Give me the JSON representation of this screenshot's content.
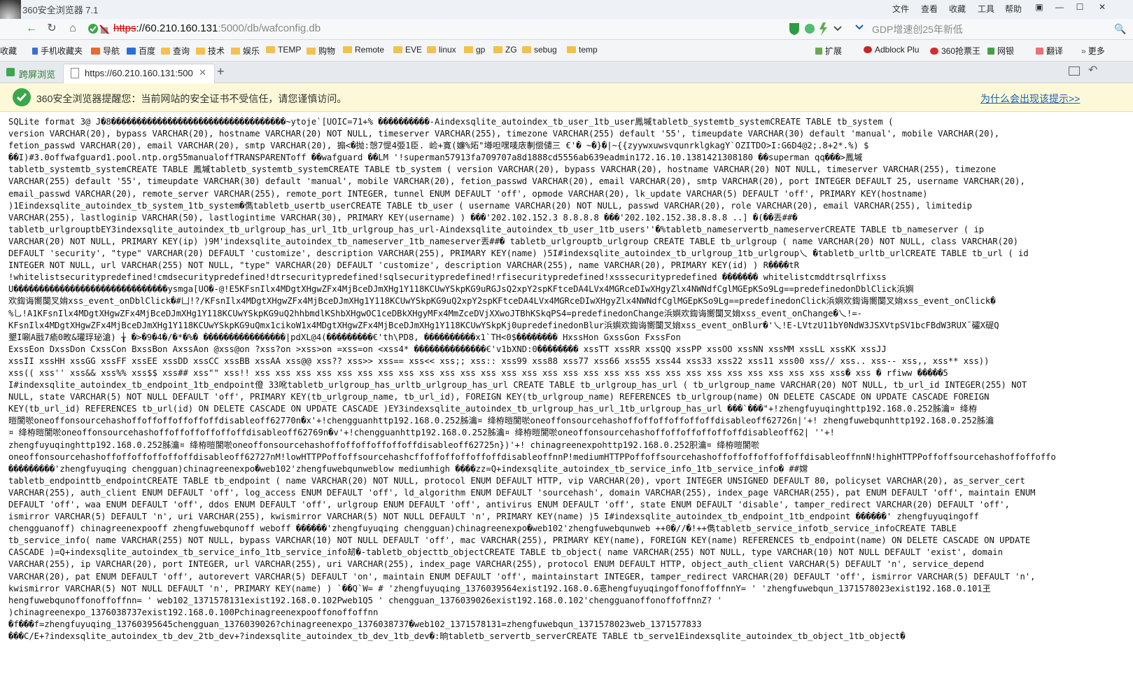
{
  "titlebar": {
    "app_title": "360安全浏览器 7.1",
    "menu": [
      "文件",
      "查看",
      "收藏",
      "工具",
      "帮助"
    ],
    "controls": [
      "▣",
      "—",
      "☐",
      "✕"
    ]
  },
  "navbar": {
    "url_scheme": "https",
    "url_host": "://60.210.160.131",
    "url_rest": ":5000/db/wafconfig.db",
    "search_placeholder": "GDP增速创25年新低"
  },
  "bookmarks": {
    "items": [
      "收藏",
      "手机收藏夹",
      "导航",
      "百度",
      "查询",
      "技术",
      "娱乐",
      "TEMP",
      "购物",
      "Remote",
      "EVE",
      "linux",
      "gp",
      "ZG",
      "sebug",
      "temp"
    ],
    "right_items": [
      "扩展",
      "Adblock Plu",
      "360抢票王",
      "网银",
      "翻译",
      "更多"
    ]
  },
  "tabs": [
    {
      "label": "跨屏浏览"
    },
    {
      "label": "https://60.210.160.131:5000/"
    }
  ],
  "notice": {
    "text": "360安全浏览器提醒您：当前网站的安全证书不受信任，请您谨慎访问。",
    "link": "为什么会出现该提示>>"
  },
  "content": {
    "lines": [
      "SQLite format 3@ J�8����������������������������������~ytoje`[UOIC=71+% ����������-Aindexsqlite_autoindex_tb_user_1tb_user鳳墄tabletb_systemtb_systemCREATE TABLE tb_system (",
      "version VARCHAR(20), bypass VARCHAR(20), hostname VARCHAR(20) NOT NULL, timeserver VARCHAR(255), timezone VARCHAR(255) default '55', timeupdate VARCHAR(30) default 'manual', mobile VARCHAR(20),",
      "fetion_passwd VARCHAR(20), email VARCHAR(20), smtp VARCHAR(20), 搧<�抛:愨7惿4弫1臣. 崄+寛(嬚%炻\"墫呾嘿唛庡剸偿儙三  €'� ~�}�|~{{zyywxuwsvqunrklgkagY`OZITDO>I:G6D4@2;.8+2*.%) $",
      "��I)#3.0offwafguard1.pool.ntp.org55manualoffTRANSPARENToff ��wafguard ��LM '!superman57913fa709707a8d1888cd5556ab639eadmin172.16.10.1381421308180 ��superman qq���>鳳墄",
      "tabletb_systemtb_systemCREATE TABLE 鳳墄tabletb_systemtb_systemCREATE TABLE tb_system ( version VARCHAR(20), bypass VARCHAR(20), hostname VARCHAR(20) NOT NULL, timeserver VARCHAR(255), timezone",
      "VARCHAR(255) default '55', timeupdate VARCHAR(30) default 'manual', mobile VARCHAR(20), fetion_passwd VARCHAR(20), email VARCHAR(20), smtp VARCHAR(20), port INTEGER DEFAULT 25, username VARCHAR(20),",
      "email_passwd VARCHAR(20), remote_server VARCHAR(255), remote_port INTEGER, tunnel ENUM DEFAULT 'off', opmode VARCHAR(20), lk_update VARCHAR(5) DEFAULT 'off', PRIMARY KEY(hostname)",
      ")1Eindexsqlite_autoindex_tb_system_1tb_system�儁tabletb_usertb_userCREATE TABLE tb_user ( username VARCHAR(20) NOT NULL, passwd VARCHAR(20), role VARCHAR(20), email VARCHAR(255), limitedip",
      "VARCHAR(255), lastloginip VARCHAR(50), lastlogintime VARCHAR(30), PRIMARY KEY(username) ) ���'202.102.152.3 8.8.8.8 ���'202.102.152.38.8.8.8 ..] �(��丟##�",
      "tabletb_urlgrouptbEY3indexsqlite_autoindex_tb_urlgroup_has_url_1tb_urlgroup_has_url-Aindexsqlite_autoindex_tb_user_1tb_users''�%tabletb_nameservertb_nameserverCREATE TABLE tb_nameserver ( ip",
      "VARCHAR(20) NOT NULL, PRIMARY KEY(ip) )9M'indexsqlite_autoindex_tb_nameserver_1tb_nameserver丟##� tabletb_urlgrouptb_urlgroup CREATE TABLE tb_urlgroup ( name VARCHAR(20) NOT NULL, class VARCHAR(20)",
      "DEFAULT 'security', \"type\" VARCHAR(20) DEFAULT 'customize', description VARCHAR(255), PRIMARY KEY(name) )5I#indexsqlite_autoindex_tb_urlgroup_1tb_urlgroup乀 �tabletb_urltb_urlCREATE TABLE tb_url ( id",
      "INTEGER NOT NULL, url VARCHAR(255) NOT NULL, \"type\" VARCHAR(20) DEFAULT 'customize', description VARCHAR(255), name VARCHAR(20), PRIMARY KEY(id) ) R����tR",
      "!whitelistsecuritypredefined!cmdsecuritypredefined!dtrsecuritypredefined!sqlsecuritypredefined!rfisecuritypredefined!xsssecuritypredefined ������� whitelistcmddtrsqlrfixss",
      "U������������������������������ysmga[UO�-@!E5KFsnIlx4MDgtXHgwZFx4MjBceDJmXHg1Y118KCUwYSkpKG9uRGJsQ2xpY2spKFtceDA4LVx4MGRceDIwXHgyZlx4NWNdfCglMGEpKSo9Lg==predefinedonDblClick浜嬩",
      "欢鍧诲嚮闅叉姢xss_event_onDblClick�#凵!?/KFsnIlx4MDgtXHgwZFx4MjBceDJmXHg1Y118KCUwYSkpKG9uQ2xpY2spKFtceDA4LVx4MGRceDIwXHgyZlx4NWNdfCglMGEpKSo9Lg==predefinedonClick浜嬩欢鍧诲嚮闅叉姢xss_event_onClick�",
      "%乚!A1KFsnIlx4MDgtXHgwZFx4MjBceDJmXHg1Y118KCUwYSkpKG9uQ2hhbmdlKShbXHgwOC1ceDBkXHgyMFx4MmZceDVjXXwoJTBhKSkqPS4=predefinedonChange浜嬩欢鍧诲嚮闅叉姢xss_event_onChange�乀!=-",
      "KFsnIlx4MDgtXHgwZFx4MjBceDJmXHg1Y118KCUwYSkpKG9uQmx1cikoW1x4MDgtXHgwZFx4MjBceDJmXHg1Y118KCUwYSkpKj0upredefinedonBlur浜嬩欢鍧诲嚮闅叉姢xss_event_onBlur�'乀!E-LVtzU11bY0NdW3JSXVtpSV1bcFBdW3RUX¯礭X碮Q",
      "墾I唰A戩7瘉0畋&瓘琈珌滄) ╁              �>�9�4�/�*�%�  ����������������|pdXL@4(���������€'th\\PD8, ����������x1`TH<0$�������� HxssHon GxssGon FxssFon",
      "ExssEon DxssDon CxssCon BxssBon AxssAon @xss@on ?xss?on >xss>on =xss=on <xss4* ��������������€'v1bXND:0�������� xssTT xssRR xssQQ xssPP xssOO xssNN xssMM xssLL xssKK xssJJ",
      "xssII xssHH xssGG xssFF xssEE xssDD xssCC xssBB xssAA xss@@ xss?? xss>> xss== xss<< xss;; xss:: xss99 xss88 xss77 xss66 xss55 xss44 xss33 xss22 xss11 xss00 xss// xss.. xss-- xss,, xss** xss))",
      "xss(( xss'' xss&& xss%% xss$$ xss## xss\"\" xss!! xss xss xss xss xss xss xss xss xss xss xss xss xss xss xss xss xss xss xss xss xss xss xss xss xss xss xss xss xss� xss � rfiww �����5",
      "I#indexsqlite_autoindex_tb_endpoint_1tb_endpoint僜 33吪tabletb_urlgroup_has_urltb_urlgroup_has_url CREATE TABLE tb_urlgroup_has_url ( tb_urlgroup_name VARCHAR(20) NOT NULL, tb_url_id INTEGER(255) NOT",
      "NULL, state VARCHAR(5) NOT NULL DEFAULT 'off', PRIMARY KEY(tb_urlgroup_name, tb_url_id), FOREIGN KEY(tb_urlgroup_name) REFERENCES tb_urlgroup(name) ON DELETE CASCADE ON UPDATE CASCADE FOREIGN",
      "KEY(tb_url_id) REFERENCES tb_url(id) ON DELETE CASCADE ON UPDATE CASCADE )EY3indexsqlite_autoindex_tb_urlgroup_has_url_1tb_urlgroup_has_url ���`���\"+!zhengfuyuqinghttp192.168.0.252胏瀹¤  绛栫",
      "暟閬唹oneoffonsourcehashoffoffoffoffoffoffdisableoff62770n�x'+!chengguanhttp192.168.0.252胏瀹¤  绛栫暟閬唹oneoffonsourcehashoffoffoffoffoffoffdisableoff62726n|'+! zhengfuwebqunhttp192.168.0.252胏瀹",
      "¤  绛栫暟閬唹oneoffonsourcehashoffoffoffoffoffoffdisableoff62769n�v'+!chengguanhttp192.168.0.252胏瀹¤  绛栫暟閬唹oneoffonsourcehashoffoffoffoffoffoffdisableoff62| ''+!",
      "zhengfuyuqinghttp192.168.0.252胏瀹¤  绛栫暟閬唹oneoffonsourcehashoffoffoffoffoffoffdisableoff62725n})'+! chinagreenexpohttp192.168.0.252胑瀹¤  绛栫暟閬唹",
      "oneoffonsourcehashoffoffoffoffoffoffdisableoff62727nM!lowHTTPPoffoffsourcehashcffoffoffoffoffoffdisableoffnnP!mediumHTTPPoffoffsourcehashoffoffoffoffoffoffdisableoffnnN!highHTTPPoffoffsourcehashoffoffoffo",
      "���������'zhengfuyuqing chengguan)chinagreenexpo�web102'zhengfuwebqunweblow mediumhigh ����zz=Q+indexsqlite_autoindex_tb_service_info_1tb_service_info� ##嫦",
      "tabletb_endpointtb_endpointCREATE TABLE tb_endpoint ( name VARCHAR(20) NOT NULL, protocol ENUM DEFAULT HTTP, vip VARCHAR(20), vport INTEGER UNSIGNED DEFAULT 80, policyset VARCHAR(20), as_server_cert",
      "VARCHAR(255), auth_client ENUM DEFAULT 'off', log_access ENUM DEFAULT 'off', ld_algorithm ENUM DEFAULT 'sourcehash', domain VARCHAR(255), index_page VARCHAR(255), pat ENUM DEFAULT 'off', maintain ENUM",
      "DEFAULT 'off', waa ENUM DEFAULT 'off', ddos ENUM DEFAULT 'off', urlgroup ENUM DEFAULT 'off', antivirus ENUM DEFAULT 'off', state ENUM DEFAULT 'disable', tamper_redirect VARCHAR(20) DEFAULT 'off',",
      "ismirror VARCHAR(5) DEFAULT 'n', uri VARCHAR(255), kwismirror VARCHAR(5) NOT NULL DEFAULT 'n', PRIMARY KEY(name) )5 I#indexsqlite_autoindex_tb_endpoint_1tb_endpoint ������' zhengfuyuqingoff",
      "chengguanoff) chinagreenexpooff zhengfuwebqunoff weboff ������'zhengfuyuqing chengguan)chinagreenexpo�web102'zhengfuwebqunweb ++0�//�!++儁tabletb_service_infotb_service_infoCREATE TABLE",
      "tb_service_info( name VARCHAR(255) NOT NULL, bypass VARCHAR(10) NOT NULL DEFAULT 'off', mac VARCHAR(255), PRIMARY KEY(name), FOREIGN KEY(name) REFERENCES tb_endpoint(name) ON DELETE CASCADE ON UPDATE",
      "CASCADE )=Q+indexsqlite_autoindex_tb_service_info_1tb_service_info刼�-tabletb_objecttb_objectCREATE TABLE tb_object( name VARCHAR(255) NOT NULL, type VARCHAR(10) NOT NULL DEFAULT 'exist', domain",
      "VARCHAR(255), ip VARCHAR(20), port INTEGER, url VARCHAR(255), uri VARCHAR(255), index_page VARCHAR(255), protocol ENUM DEFAULT HTTP, object_auth_client VARCHAR(5) DEFAULT 'n', service_depend",
      "VARCHAR(20), pat ENUM DEFAULT 'off', autorevert VARCHAR(5) DEFAULT 'on', maintain ENUM DEFAULT 'off', maintainstart INTEGER, tamper_redirect VARCHAR(20) DEFAULT 'off', ismirror VARCHAR(5) DEFAULT 'n',",
      "kwismirror VARCHAR(5) NOT NULL DEFAULT 'n', PRIMARY KEY(name) ) `��Q`W= # 'zhengfuyuqing_1376039564exist192.168.0.6悥hengfuyuqingoffonoffoffnnY= ' 'zhengfuwebqun_1371578023exist192.168.0.101玊",
      "hengfuwebqunoffonoffoffnn= ' web102_1371578131exist192.168.0.102Pweb1Q5 ' chengguan_1376039026exist192.168.0.102'chengguanoffonoffoffnnZ? '",
      ")chinagreenexpo_1376038737exist192.168.0.100Pchinagreenexpooffonoffoffnn",
      "�f���f=zhengfuyuqing_1376039564‍5chengguan_1376039026?chinagreenexpo_1376038737�web102_1371578131=zhengfuwebqun_1371578023web_1371577833",
      "���C/E+?indexsqlite_autoindex_tb_dev_2tb_dev+?indexsqlite_autoindex_tb_dev_1tb_dev�:晌tabletb_servertb_serverCREATE TABLE tb_serve1Eindexsqlite_autoindex_tb_object_1tb_object�"
    ]
  }
}
